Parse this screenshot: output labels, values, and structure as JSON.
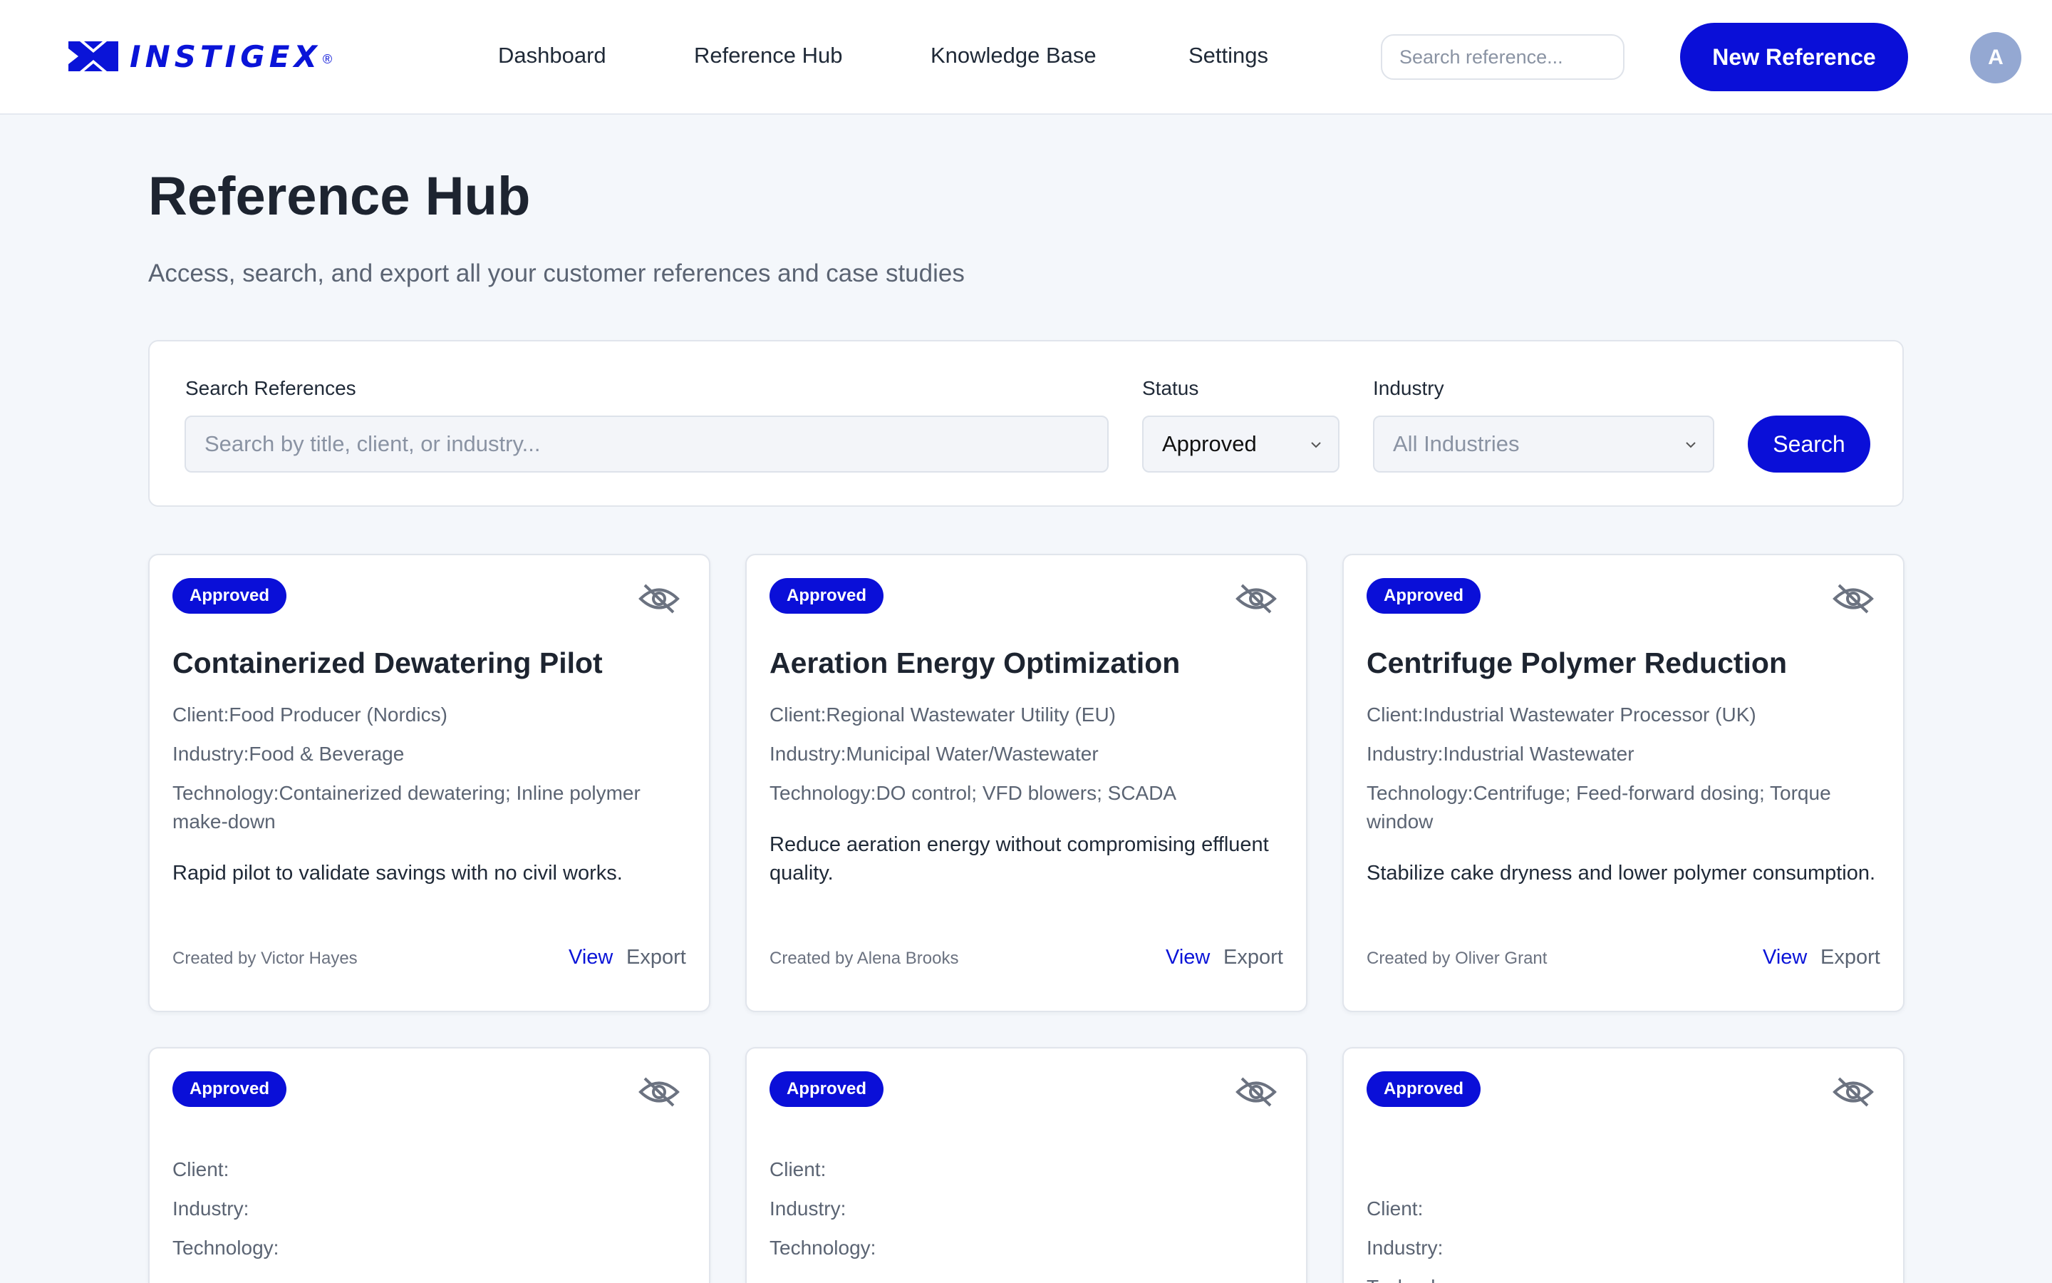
{
  "header": {
    "logo_text": "INSTIGEX",
    "logo_reg": "®",
    "nav": [
      "Dashboard",
      "Reference Hub",
      "Knowledge Base",
      "Settings"
    ],
    "search_placeholder": "Search reference...",
    "new_button": "New Reference",
    "avatar_initial": "A"
  },
  "page": {
    "title": "Reference Hub",
    "subtitle": "Access, search, and export all your customer references and case studies"
  },
  "filters": {
    "search_label": "Search References",
    "search_placeholder": "Search by title, client, or industry...",
    "status_label": "Status",
    "status_value": "Approved",
    "industry_label": "Industry",
    "industry_value": "All Industries",
    "search_button": "Search"
  },
  "cards": [
    {
      "badge": "Approved",
      "title": "Containerized Dewatering Pilot",
      "client_label": "Client:",
      "client": "Food Producer (Nordics)",
      "industry_label": "Industry:",
      "industry": "Food & Beverage",
      "technology_label": "Technology:",
      "technology": "Containerized dewatering; Inline polymer make-down",
      "summary": "Rapid pilot to validate savings with no civil works.",
      "created_by": "Created by Victor Hayes",
      "view": "View",
      "export": "Export"
    },
    {
      "badge": "Approved",
      "title": "Aeration Energy Optimization",
      "client_label": "Client:",
      "client": "Regional Wastewater Utility (EU)",
      "industry_label": "Industry:",
      "industry": "Municipal Water/Wastewater",
      "technology_label": "Technology:",
      "technology": "DO control; VFD blowers; SCADA",
      "summary": "Reduce aeration energy without compromising effluent quality.",
      "created_by": "Created by Alena Brooks",
      "view": "View",
      "export": "Export"
    },
    {
      "badge": "Approved",
      "title": "Centrifuge Polymer Reduction",
      "client_label": "Client:",
      "client": "Industrial Wastewater Processor (UK)",
      "industry_label": "Industry:",
      "industry": "Industrial Wastewater",
      "technology_label": "Technology:",
      "technology": "Centrifuge; Feed-forward dosing; Torque window",
      "summary": "Stabilize cake dryness and lower polymer consumption.",
      "created_by": "Created by Oliver Grant",
      "view": "View",
      "export": "Export"
    },
    {
      "badge": "Approved",
      "client_label": "Client:",
      "industry_label": "Industry:",
      "technology_label": "Technology:"
    },
    {
      "badge": "Approved",
      "client_label": "Client:",
      "industry_label": "Industry:",
      "technology_label": "Technology:"
    },
    {
      "badge": "Approved",
      "client_label": "Client:",
      "industry_label": "Industry:",
      "technology_label": "Technology:"
    }
  ],
  "colors": {
    "accent": "#0a0fd8",
    "background": "#f4f7fb",
    "muted_text": "#5b6473"
  },
  "icons": {
    "logo": "instigex-logo-icon",
    "card_visibility": "eye-off-icon",
    "select": "chevron-down-icon"
  }
}
